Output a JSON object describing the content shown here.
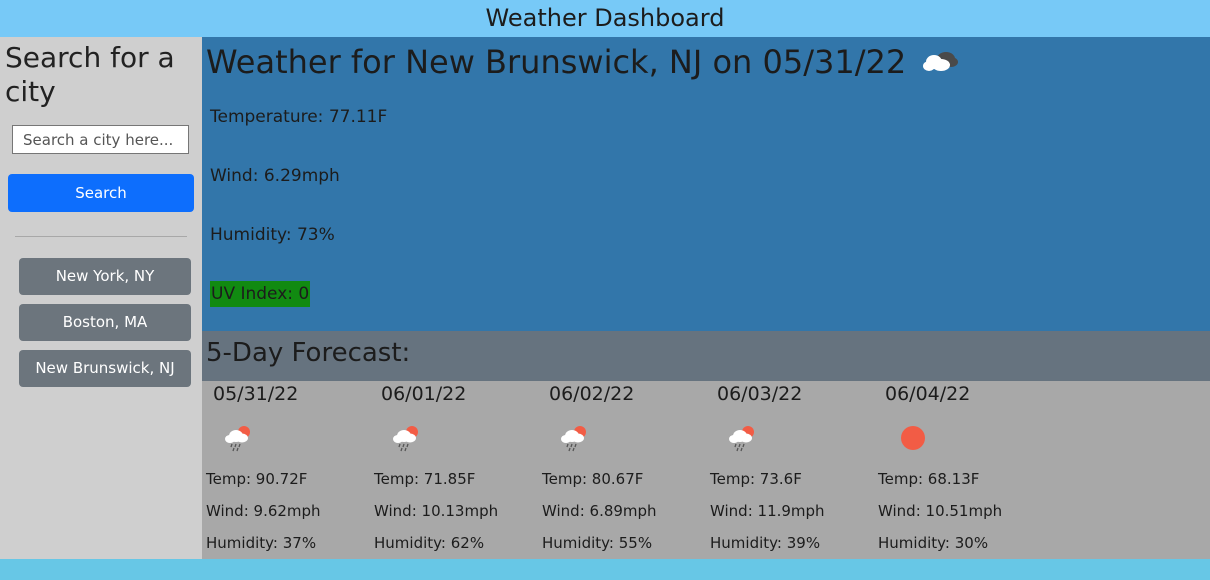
{
  "header": {
    "title": "Weather Dashboard"
  },
  "sidebar": {
    "heading": "Search for a city",
    "search_placeholder": "Search a city here...",
    "search_button": "Search",
    "history": [
      "New York, NY",
      "Boston, MA",
      "New Brunswick, NJ"
    ]
  },
  "current": {
    "title": "Weather for New Brunswick, NJ on 05/31/22",
    "icon": "cloudy-icon",
    "temperature": "Temperature: 77.11F",
    "wind": "Wind: 6.29mph",
    "humidity": "Humidity: 73%",
    "uv": "UV Index: 0",
    "uv_color": "#118a11"
  },
  "forecast": {
    "heading": "5-Day Forecast:",
    "days": [
      {
        "date": "05/31/22",
        "icon": "rain-sun-icon",
        "temp": "Temp: 90.72F",
        "wind": "Wind: 9.62mph",
        "humidity": "Humidity: 37%"
      },
      {
        "date": "06/01/22",
        "icon": "rain-sun-icon",
        "temp": "Temp: 71.85F",
        "wind": "Wind: 10.13mph",
        "humidity": "Humidity: 62%"
      },
      {
        "date": "06/02/22",
        "icon": "rain-sun-icon",
        "temp": "Temp: 80.67F",
        "wind": "Wind: 6.89mph",
        "humidity": "Humidity: 55%"
      },
      {
        "date": "06/03/22",
        "icon": "rain-sun-icon",
        "temp": "Temp: 73.6F",
        "wind": "Wind: 11.9mph",
        "humidity": "Humidity: 39%"
      },
      {
        "date": "06/04/22",
        "icon": "sun-icon",
        "temp": "Temp: 68.13F",
        "wind": "Wind: 10.51mph",
        "humidity": "Humidity: 30%"
      }
    ]
  },
  "colors": {
    "header_bg": "#77c9f7",
    "current_bg": "#3276aa",
    "search_button": "#0d6efd",
    "history_button": "#6c757d",
    "sun": "#f25c45"
  }
}
